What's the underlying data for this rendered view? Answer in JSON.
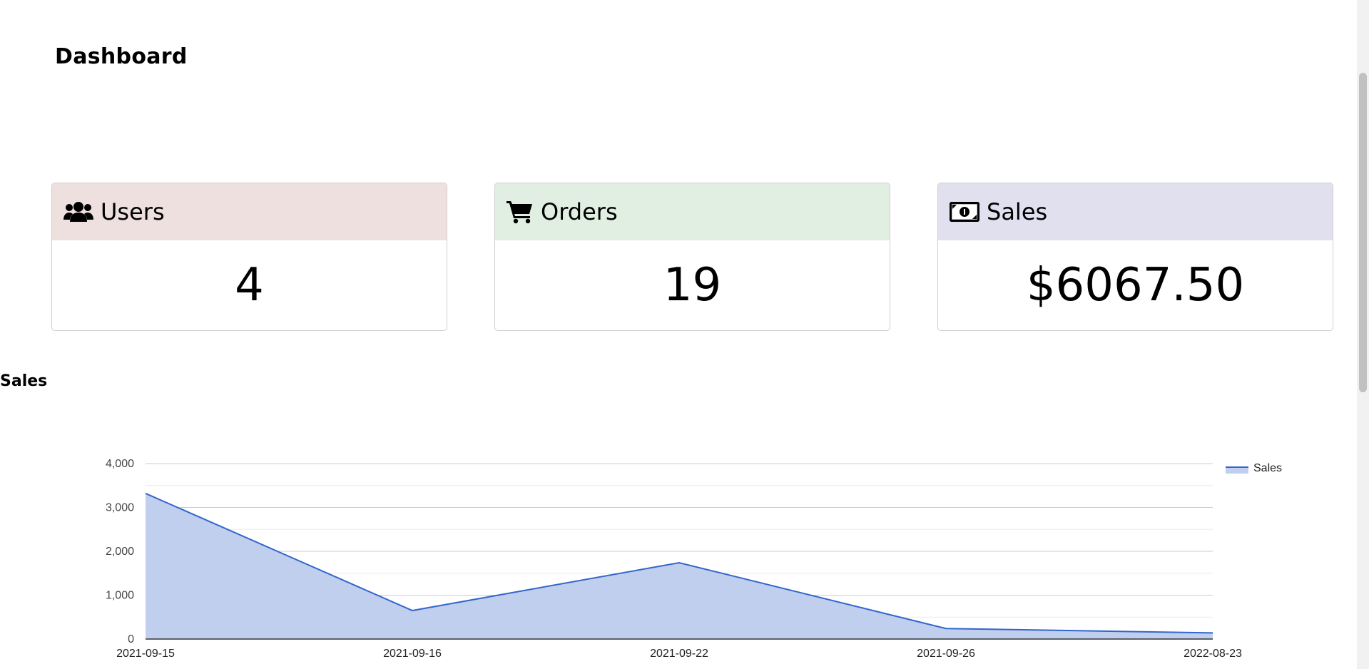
{
  "page": {
    "title": "Dashboard"
  },
  "cards": [
    {
      "label": "Users",
      "value": "4",
      "icon": "users-icon",
      "header_color": "#efe0e0"
    },
    {
      "label": "Orders",
      "value": "19",
      "icon": "cart-icon",
      "header_color": "#e0efe1"
    },
    {
      "label": "Sales",
      "value": "$6067.50",
      "icon": "money-bill-icon",
      "header_color": "#e1e0ef"
    }
  ],
  "sales_section": {
    "title": "Sales"
  },
  "chart_data": {
    "type": "area",
    "x": [
      "2021-09-15",
      "2021-09-16",
      "2021-09-22",
      "2021-09-26",
      "2022-08-23"
    ],
    "series": [
      {
        "name": "Sales",
        "values": [
          3320,
          650,
          1740,
          240,
          140
        ]
      }
    ],
    "ylim": [
      0,
      4000
    ],
    "yticks": [
      0,
      1000,
      2000,
      3000,
      4000
    ],
    "ytick_labels": [
      "0",
      "1,000",
      "2,000",
      "3,000",
      "4,000"
    ],
    "grid": true,
    "legend": "right",
    "colors": {
      "line": "#3366cc",
      "fill": "#c0cfee"
    }
  }
}
